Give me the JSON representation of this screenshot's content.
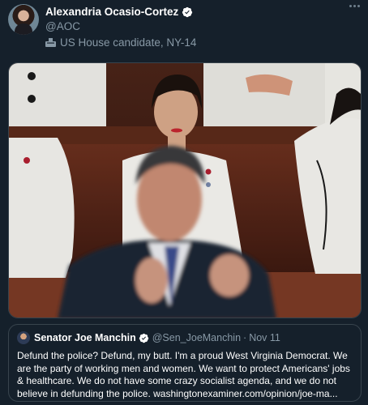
{
  "tweet": {
    "author": {
      "display_name": "Alexandria Ocasio-Cortez",
      "handle": "@AOC",
      "label": "US House candidate, NY-14",
      "label_icon": "ballot-box-icon",
      "verified": true
    },
    "more_icon": "more-options-icon",
    "media": {
      "kind": "photo"
    },
    "quoted_tweet": {
      "author_name": "Senator Joe Manchin",
      "handle": "@Sen_JoeManchin",
      "separator": "·",
      "date": "Nov 11",
      "verified": true,
      "text": "Defund the police? Defund, my butt. I'm a proud West Virginia Democrat. We are the party of working men and women. We want to protect Americans' jobs & healthcare. We do not have some crazy socialist agenda, and we do not believe in defunding the police. washingtonexaminer.com/opinion/joe-ma..."
    }
  },
  "colors": {
    "background": "#15202b",
    "border": "#38444d",
    "secondary_text": "#8899a6",
    "verified_badge": "#ffffff"
  }
}
